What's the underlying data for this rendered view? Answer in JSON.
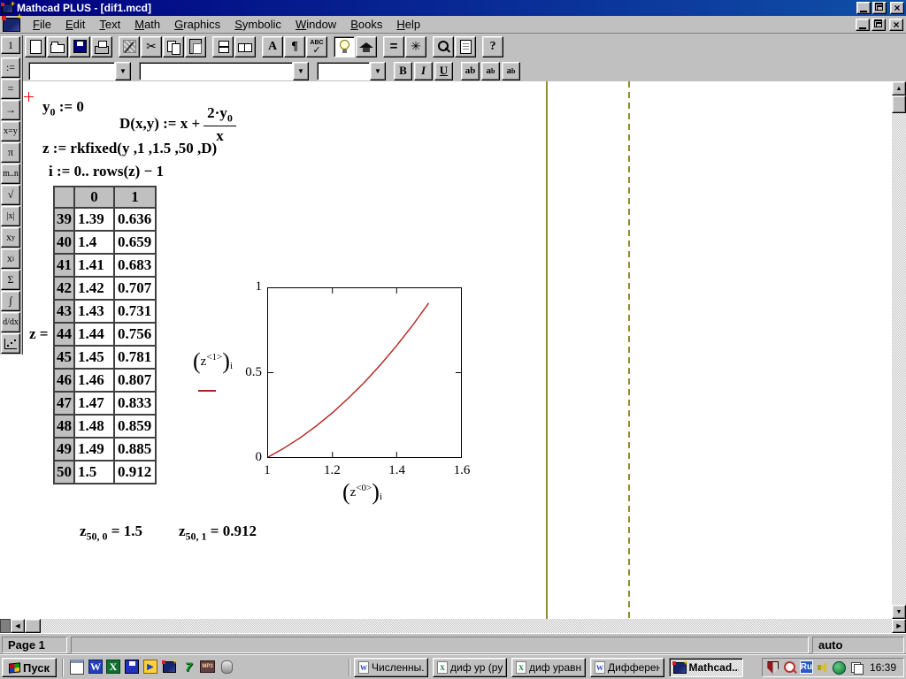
{
  "window": {
    "title": "Mathcad PLUS - [dif1.mcd]"
  },
  "menu": {
    "items": [
      "File",
      "Edit",
      "Text",
      "Math",
      "Graphics",
      "Symbolic",
      "Window",
      "Books",
      "Help"
    ]
  },
  "toolbar": {
    "buttons": [
      {
        "name": "new"
      },
      {
        "name": "open"
      },
      {
        "name": "save"
      },
      {
        "name": "print"
      },
      {
        "name": "format-painter",
        "gap_before": true
      },
      {
        "name": "cut",
        "glyph": "✂"
      },
      {
        "name": "copy"
      },
      {
        "name": "paste"
      },
      {
        "name": "separate-regions",
        "gap_before": true
      },
      {
        "name": "view-regions"
      },
      {
        "name": "font",
        "glyph": "A",
        "gap_before": true
      },
      {
        "name": "paragraph",
        "glyph": "¶"
      },
      {
        "name": "spellcheck"
      },
      {
        "name": "smart-tip",
        "pressed": true,
        "gap_before": true
      },
      {
        "name": "tutorial"
      },
      {
        "name": "calculate",
        "glyph": "=",
        "gap_before": true
      },
      {
        "name": "symbolic",
        "glyph": "✳"
      },
      {
        "name": "zoom",
        "gap_before": true
      },
      {
        "name": "print-preview"
      },
      {
        "name": "help",
        "glyph": "?",
        "gap_before": true
      }
    ]
  },
  "formatbar": {
    "style_value": "",
    "font_value": "",
    "size_value": "",
    "bold": "B",
    "italic": "I",
    "underline": "U",
    "vanilla": "ab",
    "sub_base": "a",
    "sub_mark": "b",
    "sup_base": "a",
    "sup_mark": "b"
  },
  "palette": {
    "items": [
      {
        "name": "numeric-format",
        "label": "1"
      },
      {
        "name": "assign",
        "label": ":="
      },
      {
        "name": "evaluate",
        "label": "="
      },
      {
        "name": "arrow",
        "label": "→"
      },
      {
        "name": "boolean",
        "label": "x=y",
        "small": true
      },
      {
        "name": "pi",
        "label": "π"
      },
      {
        "name": "range",
        "label": "m..n",
        "small": true
      },
      {
        "name": "root",
        "label": "√"
      },
      {
        "name": "absolute",
        "label": "|x|",
        "small": true
      },
      {
        "name": "power",
        "base": "x",
        "sup": "y"
      },
      {
        "name": "subscript",
        "base": "x",
        "sub": "i"
      },
      {
        "name": "summation",
        "label": "Σ"
      },
      {
        "name": "integral",
        "label": "∫"
      },
      {
        "name": "derivative",
        "base": "d/dx",
        "small": true
      },
      {
        "name": "plot-palette",
        "icon": "plot"
      }
    ]
  },
  "worksheet": {
    "expr1": {
      "base": "y",
      "sub": "0",
      "rest": " := 0"
    },
    "expr2": {
      "lhs": "D(x,y) := x +",
      "num_base": "2·y",
      "num_sub": "0",
      "den": "x"
    },
    "expr3": "z := rkfixed(y ,1 ,1.5 ,50 ,D)",
    "expr4": "i := 0.. rows(z) − 1",
    "result1": {
      "base": "z",
      "sub": "50, 0",
      "rhs": " = 1.5"
    },
    "result2": {
      "base": "z",
      "sub": "50, 1",
      "rhs": " = 0.912"
    }
  },
  "table": {
    "label": "z =",
    "col_headers": [
      "0",
      "1"
    ],
    "rows": [
      [
        "39",
        "1.39",
        "0.636"
      ],
      [
        "40",
        "1.4",
        "0.659"
      ],
      [
        "41",
        "1.41",
        "0.683"
      ],
      [
        "42",
        "1.42",
        "0.707"
      ],
      [
        "43",
        "1.43",
        "0.731"
      ],
      [
        "44",
        "1.44",
        "0.756"
      ],
      [
        "45",
        "1.45",
        "0.781"
      ],
      [
        "46",
        "1.46",
        "0.807"
      ],
      [
        "47",
        "1.47",
        "0.833"
      ],
      [
        "48",
        "1.48",
        "0.859"
      ],
      [
        "49",
        "1.49",
        "0.885"
      ],
      [
        "50",
        "1.5",
        "0.912"
      ]
    ]
  },
  "chart_data": {
    "type": "line",
    "title": "",
    "xlabel": {
      "lparen": "(",
      "base": "z",
      "sup": "<0>",
      "rparen": ")",
      "sub": "i"
    },
    "ylabel": {
      "lparen": "(",
      "base": "z",
      "sup": "<1>",
      "rparen": ")",
      "sub": "i"
    },
    "xlim": [
      1,
      1.6
    ],
    "ylim": [
      0,
      1
    ],
    "x_ticks": [
      1,
      1.2,
      1.4,
      1.6
    ],
    "y_ticks": [
      0,
      0.5,
      1
    ],
    "x_tick_labels": [
      "1",
      "1.2",
      "1.4",
      "1.6"
    ],
    "y_tick_labels": [
      "0",
      "0.5",
      "1"
    ],
    "grid": false,
    "legend_position": "left",
    "series": [
      {
        "name": "(z<1>)i vs (z<0>)i",
        "color": "#b22020",
        "x": [
          1.0,
          1.05,
          1.1,
          1.15,
          1.2,
          1.25,
          1.3,
          1.35,
          1.4,
          1.45,
          1.5
        ],
        "y": [
          0.0,
          0.054,
          0.115,
          0.185,
          0.262,
          0.349,
          0.443,
          0.547,
          0.66,
          0.781,
          0.912
        ]
      }
    ]
  },
  "statusbar": {
    "page": "Page 1",
    "middle": "",
    "mode": "auto"
  },
  "taskbar": {
    "start_label": "Пуск",
    "quicklaunch": [
      "show-desktop",
      "word",
      "excel",
      "backup",
      "media-player",
      "mathcad",
      "v7",
      "mp3",
      "mouse"
    ],
    "tasks": [
      {
        "label": "Численны...",
        "icon": "word-doc"
      },
      {
        "label": "диф ур (ру...",
        "icon": "excel-doc"
      },
      {
        "label": "диф уравн...",
        "icon": "excel-doc"
      },
      {
        "label": "Дифферен...",
        "icon": "word-doc"
      },
      {
        "label": "Mathcad...",
        "icon": "mathcad",
        "active": true
      }
    ],
    "tray": {
      "icons": [
        "antivirus-shield",
        "find-clock",
        "lang-ru",
        "volume",
        "network-globe",
        "window-stack"
      ],
      "lang": "Ru",
      "time": "16:39"
    }
  }
}
